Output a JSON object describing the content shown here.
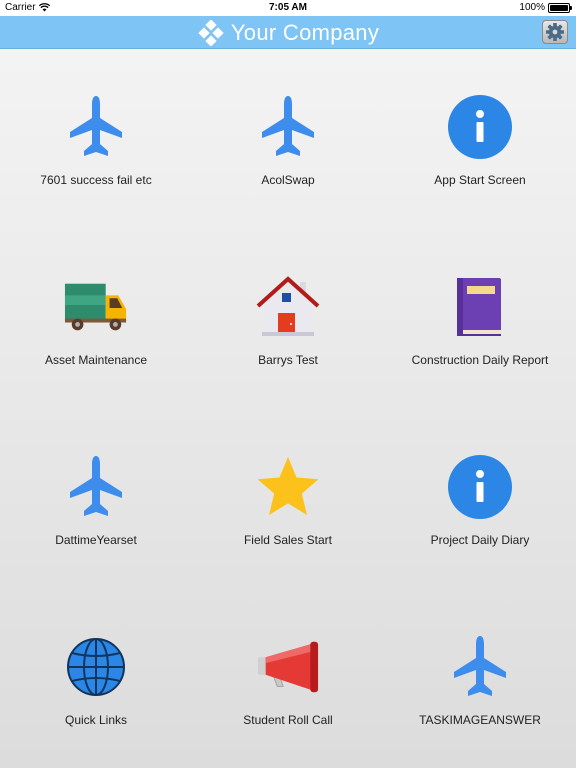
{
  "status_bar": {
    "carrier": "Carrier",
    "time": "7:05 AM",
    "battery": "100%"
  },
  "header": {
    "title": "Your Company",
    "brand_color": "#7ec4f5"
  },
  "tiles": [
    {
      "label": "7601 success fail etc",
      "icon": "airplane-icon"
    },
    {
      "label": "AcolSwap",
      "icon": "airplane-icon"
    },
    {
      "label": "App Start Screen",
      "icon": "info-icon"
    },
    {
      "label": "Asset Maintenance",
      "icon": "truck-icon"
    },
    {
      "label": "Barrys Test",
      "icon": "house-icon"
    },
    {
      "label": "Construction Daily Report",
      "icon": "book-icon"
    },
    {
      "label": "DattimeYearset",
      "icon": "airplane-icon"
    },
    {
      "label": "Field Sales Start",
      "icon": "star-icon"
    },
    {
      "label": "Project Daily Diary",
      "icon": "info-icon"
    },
    {
      "label": "Quick Links",
      "icon": "globe-icon"
    },
    {
      "label": "Student Roll Call",
      "icon": "megaphone-icon"
    },
    {
      "label": "TASKIMAGEANSWER",
      "icon": "airplane-icon"
    }
  ]
}
